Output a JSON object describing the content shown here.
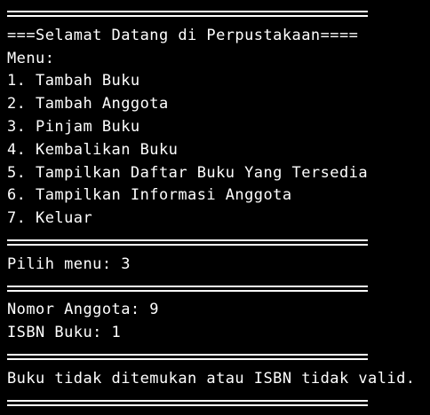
{
  "terminal": {
    "lines": [
      {
        "type": "separator",
        "text": "===================================="
      },
      {
        "type": "text",
        "text": "===Selamat Datang di Perpustakaan===="
      },
      {
        "type": "text",
        "text": "Menu:"
      },
      {
        "type": "text",
        "text": "1. Tambah Buku"
      },
      {
        "type": "text",
        "text": "2. Tambah Anggota"
      },
      {
        "type": "text",
        "text": "3. Pinjam Buku"
      },
      {
        "type": "text",
        "text": "4. Kembalikan Buku"
      },
      {
        "type": "text",
        "text": "5. Tampilkan Daftar Buku Yang Tersedia"
      },
      {
        "type": "text",
        "text": "6. Tampilkan Informasi Anggota"
      },
      {
        "type": "text",
        "text": "7. Keluar"
      },
      {
        "type": "separator",
        "text": "===================================="
      },
      {
        "type": "text",
        "text": "Pilih menu: 3"
      },
      {
        "type": "separator",
        "text": "===================================="
      },
      {
        "type": "text",
        "text": "Nomor Anggota: 9"
      },
      {
        "type": "text",
        "text": "ISBN Buku: 1"
      },
      {
        "type": "separator",
        "text": "===================================="
      },
      {
        "type": "text",
        "text": "Buku tidak ditemukan atau ISBN tidak valid."
      },
      {
        "type": "separator",
        "text": "===================================="
      }
    ]
  },
  "colors": {
    "background": "#000000",
    "foreground": "#ffffff"
  }
}
